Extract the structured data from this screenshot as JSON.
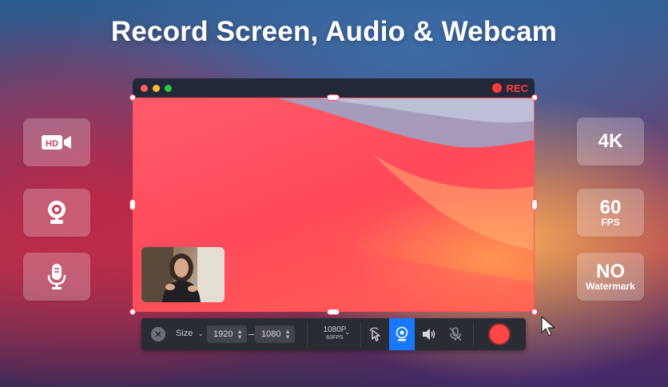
{
  "headline": "Record Screen, Audio & Webcam",
  "left_features": [
    {
      "icon": "hd-video-icon",
      "label": "HD"
    },
    {
      "icon": "webcam-icon"
    },
    {
      "icon": "microphone-icon"
    }
  ],
  "right_features": [
    {
      "line1": "4K"
    },
    {
      "line1": "60",
      "line2": "FPS"
    },
    {
      "line1": "NO",
      "line2": "Watermark"
    }
  ],
  "window": {
    "rec_label": "REC",
    "traffic_lights": [
      "#ff5f57",
      "#febc2e",
      "#28c840"
    ]
  },
  "toolbar": {
    "size_label": "Size",
    "width_value": "1920",
    "separator": "–",
    "height_value": "1080",
    "resolution": "1080P",
    "fps": "60FPS"
  },
  "colors": {
    "accent": "#1a78ff",
    "record": "#ff4747",
    "selection": "#ff4d5e"
  }
}
